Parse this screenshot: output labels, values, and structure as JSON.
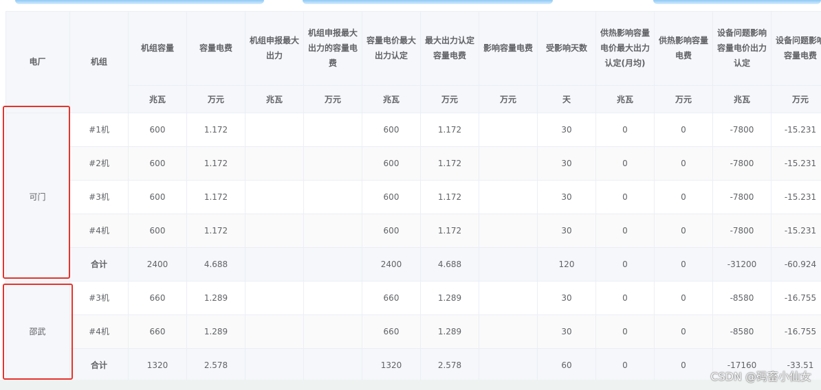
{
  "table": {
    "headers": {
      "plant": "电厂",
      "unit_name": "机组",
      "capacity": "机组容量",
      "capacity_fee": "容量电费",
      "declared_max": "机组申报最大出力",
      "declared_max_fee": "机组申报最大出力的容量电费",
      "price_max_output": "容量电价最大出力认定",
      "max_output_fee": "最大出力认定容量电费",
      "affect_fee": "影响容量电费",
      "affected_days": "受影响天数",
      "heat_max_output": "供热影响容量电价最大出力认定(月均)",
      "heat_fee": "供热影响容量电费",
      "equip_max_output": "设备问题影响容量电价出力认定",
      "equip_fee": "设备问题影响容量电费"
    },
    "units": {
      "capacity": "兆瓦",
      "capacity_fee": "万元",
      "declared_max": "兆瓦",
      "declared_max_fee": "万元",
      "price_max_output": "兆瓦",
      "max_output_fee": "万元",
      "affect_fee": "万元",
      "affected_days": "天",
      "heat_max_output": "兆瓦",
      "heat_fee": "万元",
      "equip_max_output": "兆瓦",
      "equip_fee": "万元"
    },
    "plants": [
      {
        "name": "可门",
        "rows": [
          {
            "unit": "#1机",
            "capacity": "600",
            "capacity_fee": "1.172",
            "declared_max": "",
            "declared_max_fee": "",
            "price_max_output": "600",
            "max_output_fee": "1.172",
            "affect_fee": "",
            "affected_days": "30",
            "heat_max_output": "0",
            "heat_fee": "0",
            "equip_max_output": "-7800",
            "equip_fee": "-15.231"
          },
          {
            "unit": "#2机",
            "capacity": "600",
            "capacity_fee": "1.172",
            "declared_max": "",
            "declared_max_fee": "",
            "price_max_output": "600",
            "max_output_fee": "1.172",
            "affect_fee": "",
            "affected_days": "30",
            "heat_max_output": "0",
            "heat_fee": "0",
            "equip_max_output": "-7800",
            "equip_fee": "-15.231"
          },
          {
            "unit": "#3机",
            "capacity": "600",
            "capacity_fee": "1.172",
            "declared_max": "",
            "declared_max_fee": "",
            "price_max_output": "600",
            "max_output_fee": "1.172",
            "affect_fee": "",
            "affected_days": "30",
            "heat_max_output": "0",
            "heat_fee": "0",
            "equip_max_output": "-7800",
            "equip_fee": "-15.231"
          },
          {
            "unit": "#4机",
            "capacity": "600",
            "capacity_fee": "1.172",
            "declared_max": "",
            "declared_max_fee": "",
            "price_max_output": "600",
            "max_output_fee": "1.172",
            "affect_fee": "",
            "affected_days": "30",
            "heat_max_output": "0",
            "heat_fee": "0",
            "equip_max_output": "-7800",
            "equip_fee": "-15.231"
          },
          {
            "unit": "合计",
            "capacity": "2400",
            "capacity_fee": "4.688",
            "declared_max": "",
            "declared_max_fee": "",
            "price_max_output": "2400",
            "max_output_fee": "4.688",
            "affect_fee": "",
            "affected_days": "120",
            "heat_max_output": "0",
            "heat_fee": "0",
            "equip_max_output": "-31200",
            "equip_fee": "-60.924",
            "is_total": true
          }
        ]
      },
      {
        "name": "邵武",
        "rows": [
          {
            "unit": "#3机",
            "capacity": "660",
            "capacity_fee": "1.289",
            "declared_max": "",
            "declared_max_fee": "",
            "price_max_output": "660",
            "max_output_fee": "1.289",
            "affect_fee": "",
            "affected_days": "30",
            "heat_max_output": "0",
            "heat_fee": "0",
            "equip_max_output": "-8580",
            "equip_fee": "-16.755"
          },
          {
            "unit": "#4机",
            "capacity": "660",
            "capacity_fee": "1.289",
            "declared_max": "",
            "declared_max_fee": "",
            "price_max_output": "660",
            "max_output_fee": "1.289",
            "affect_fee": "",
            "affected_days": "30",
            "heat_max_output": "0",
            "heat_fee": "0",
            "equip_max_output": "-8580",
            "equip_fee": "-16.755"
          },
          {
            "unit": "合计",
            "capacity": "1320",
            "capacity_fee": "2.578",
            "declared_max": "",
            "declared_max_fee": "",
            "price_max_output": "1320",
            "max_output_fee": "2.578",
            "affect_fee": "",
            "affected_days": "60",
            "heat_max_output": "0",
            "heat_fee": "0",
            "equip_max_output": "-17160",
            "equip_fee": "-33.51",
            "is_total": true
          }
        ]
      }
    ]
  },
  "colors": {
    "header_bg": "#f5f7fa",
    "border": "#ebeef5",
    "text": "#606266",
    "highlight_box": "#e8322c"
  },
  "watermark": "CSDN @码畜小仙女"
}
